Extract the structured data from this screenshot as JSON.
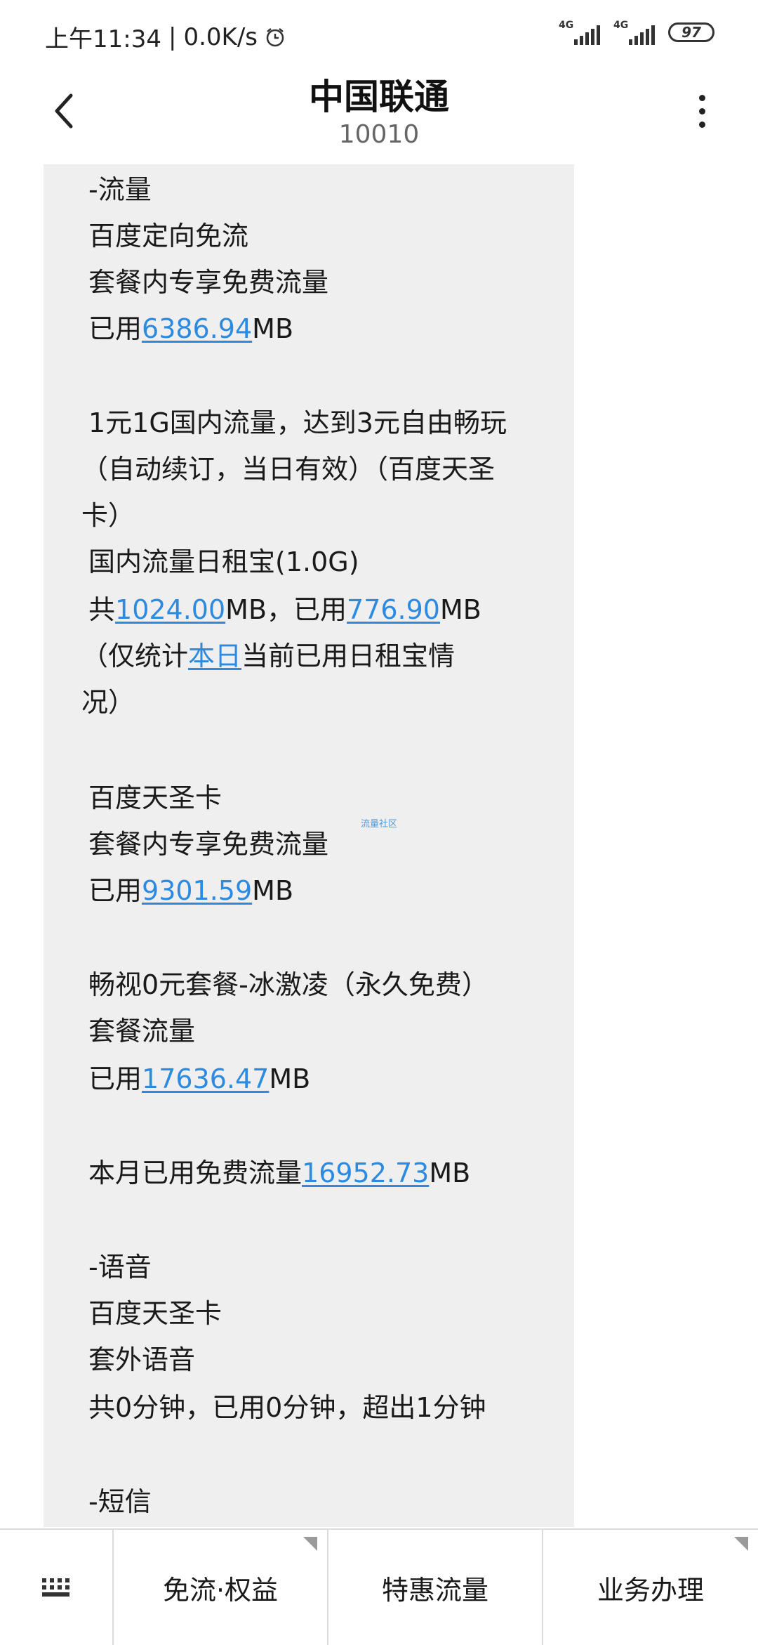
{
  "status_bar": {
    "time": "上午11:34",
    "separator": "|",
    "speed": "0.0K/s",
    "network_1": "4G",
    "network_2": "4G",
    "battery": "97"
  },
  "header": {
    "contact_name": "中国联通",
    "contact_number": "10010"
  },
  "message": {
    "lines": [
      {
        "t": "-流量"
      },
      {
        "t": "百度定向免流"
      },
      {
        "t": "套餐内专享免费流量"
      },
      {
        "pre": "已用",
        "link": "6386.94",
        "post": "MB"
      },
      {
        "t": "1元1G国内流量，达到3元自由畅玩"
      },
      {
        "t": "（自动续订，当日有效）（百度天圣"
      },
      {
        "t": "卡）"
      },
      {
        "t": "国内流量日租宝(1.0G)"
      },
      {
        "pre": "共",
        "link": "1024.00",
        "mid": "MB，已用",
        "link2": "776.90",
        "post": "MB"
      },
      {
        "pre": "（仅统计",
        "link": "本日",
        "post": "当前已用日租宝情"
      },
      {
        "t": "况）"
      },
      {
        "t": "百度天圣卡"
      },
      {
        "t": "套餐内专享免费流量"
      },
      {
        "pre": "已用",
        "link": "9301.59",
        "post": "MB"
      },
      {
        "t": "畅视0元套餐-冰激凌（永久免费）"
      },
      {
        "t": "套餐流量"
      },
      {
        "pre": "已用",
        "link": "17636.47",
        "post": "MB"
      },
      {
        "pre": "本月已用免费流量",
        "link": "16952.73",
        "post": "MB"
      },
      {
        "t": "-语音"
      },
      {
        "t": "百度天圣卡"
      },
      {
        "t": "套外语音"
      },
      {
        "t": "共0分钟，已用0分钟，超出1分钟"
      },
      {
        "t": "-短信"
      }
    ],
    "watermark": "流量社区"
  },
  "bottom_menu": {
    "items": [
      {
        "label": "免流·权益"
      },
      {
        "label": "特惠流量"
      },
      {
        "label": "业务办理"
      }
    ]
  },
  "colors": {
    "link": "#2c8be0",
    "bubble": "#efefef"
  }
}
